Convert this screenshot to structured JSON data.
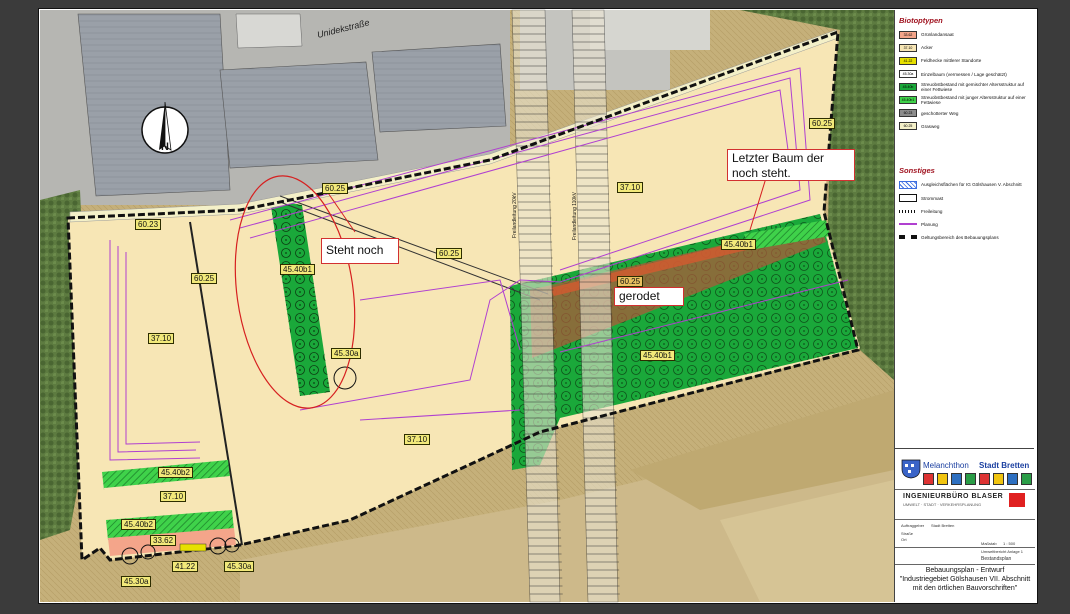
{
  "street_name": "Unidekstraße",
  "north_arrow_letter": "N",
  "road_labels": [
    "Freilandleitung 20kV",
    "Freilandleitung 110kV"
  ],
  "map_labels": {
    "a6025_top": "60.25",
    "a6025_right": "60.25",
    "a6025_mid": "60.25",
    "a6025_left": "60.25",
    "a6025_red": "60.25",
    "a6023": "60.23",
    "a3710_left": "37.10",
    "a3710_top": "37.10",
    "a3710_center": "37.10",
    "a3710_bottom": "37.10",
    "a4540b1_left": "45.40b1",
    "a4540b1_right": "45.40b1",
    "a4540b1_green": "45.40b1",
    "a4530a_mid": "45.30a",
    "a4540b2_top": "45.40b2",
    "a4540b2_bot": "45.40b2",
    "a3362": "33.62",
    "a4122": "41.22",
    "a4530a_b1": "45.30a",
    "a4530a_b2": "45.30a"
  },
  "callouts": {
    "letzter_baum": "Letzter Baum der noch steht.",
    "steht_noch": "Steht noch",
    "gerodet": "gerodet"
  },
  "legend": {
    "biotope_heading": "Biotoptypen",
    "biotope": [
      {
        "code": "33.62",
        "label": "Grünlandansaat",
        "color": "#f4a58a"
      },
      {
        "code": "37.10",
        "label": "Acker",
        "color": "#f7e6b5"
      },
      {
        "code": "41.22",
        "label": "Feldhecke mittlerer Standorte",
        "color": "#e7e000"
      },
      {
        "code": "45.30a",
        "label": "Einzelbaum (vermessen / Lage geschätzt)",
        "color": "#ffffff"
      },
      {
        "code": "45.40b",
        "label": "Streuobstbestand mit gemischter Altersstruktur auf einer Fettwiese",
        "color": "#1aa83a"
      },
      {
        "code": "45.40b1",
        "label": "Streuobstbestand mit junger Altersstruktur auf einer Fettwiese",
        "color": "#3fd24a"
      },
      {
        "code": "60.23",
        "label": "geschotterter Weg",
        "color": "#8c8c8c"
      },
      {
        "code": "60.25",
        "label": "Grasweg",
        "color": "#f4f0c8"
      }
    ],
    "other_heading": "Sonstiges",
    "other": [
      {
        "label": "Ausgleichsflächen für IG Gölshausen V. Abschnitt"
      },
      {
        "label": "Strommast"
      },
      {
        "label": "Freileitung"
      },
      {
        "label": "Planung"
      },
      {
        "label": "Geltungsbereich des Bebauungsplans"
      }
    ]
  },
  "titleblock": {
    "logo_city": "Melanchthon",
    "logo_name": "Stadt Bretten",
    "firm": "INGENIEURBÜRO BLASER",
    "firm_sub": "UMWELT · STADT · VERKEHRSPLANUNG",
    "auftraggeber_label": "Auftraggeber",
    "auftraggeber_value": "Stadt Bretten",
    "strasse_label": "Straße",
    "ort_label": "Ort",
    "massstab_label": "Maßstab",
    "massstab_value": "1 : 500",
    "doc_id": "Umweltbericht Anlage 1",
    "doc_type": "Bestandsplan",
    "plan_title_1": "Bebauungsplan - Entwurf",
    "plan_title_2": "\"Industriegebiet Gölshausen VII. Abschnitt",
    "plan_title_3": "mit den örtlichen Bauvorschriften\""
  }
}
